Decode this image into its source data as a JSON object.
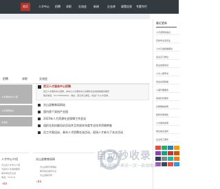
{
  "nav": {
    "items": [
      {
        "label": "首页",
        "active": true
      },
      {
        "label": "人才中心"
      },
      {
        "label": "招聘"
      },
      {
        "label": "求职"
      },
      {
        "label": "交流会"
      },
      {
        "label": "新闻"
      },
      {
        "label": "企业库"
      },
      {
        "label": "政策信息"
      },
      {
        "label": "专题专栏"
      }
    ]
  },
  "sidebar": {
    "title": "最近更新",
    "items": [
      "人才招聘会信息",
      "高校毕业生就业",
      "人才引进政策解读",
      "就业见习岗位",
      "职业技能培训",
      "人才公寓申请",
      "创业扶持政策",
      "人事代理服务",
      "档案托管服务",
      "社保缴纳指南",
      "职称评审通知",
      "人才服务指南",
      "岗位信息发布",
      "企业用工服务"
    ]
  },
  "tabs": [
    "招聘",
    "求职",
    "交流会"
  ],
  "thumbs": [
    {
      "label": "人才服务中心介绍"
    },
    {
      "label": "人才招聘信息"
    },
    {
      "label": "交流会"
    }
  ],
  "headline": {
    "title": "武汉人才服务中心招聘",
    "desc_lines": [
      "武汉人才服务中心招聘，本中心人才服务中心办理毕业生档案等相关服务",
      "联系电话：027-85550000，地址：武汉市江岸区，欢迎广大人才咨询"
    ]
  },
  "news_list": [
    "光山县教育局网站",
    "国内首个双创产业园",
    "2023年人力资源社会保障工作会议",
    "组织业务技能培训活动并且完成本年度专业技术资格审查",
    "员工代表培训，青年人才招聘交流活动，现场人才参与了本次活动"
  ],
  "panels": {
    "left": {
      "title": "人才中心介绍",
      "lines": [
        "光山县人才中心介绍",
        "为县内人才提供服务",
        "联系地址光山县",
        "电话：0376-8"
      ]
    },
    "mid": {
      "title": "光山县教育局网",
      "lines": [
        "光山县教育局网站",
        "教育信息发布平台",
        "光山县教育局"
      ],
      "more": "+更多"
    },
    "left_more": "+更多"
  },
  "grid_colors": [
    "#e74c3c",
    "#27ae60",
    "#2980b9",
    "#f39c12",
    "#8e44ad",
    "#16a085",
    "#c0392b",
    "#d35400",
    "#2c3e50",
    "#7f8c8d",
    "#1abc9c",
    "#e67e22",
    "#9b59b6",
    "#34495e",
    "#e74c3c",
    "#3498db"
  ],
  "watermark": {
    "title": "自动秒收录",
    "sub": "做上链接一来访一次一自动收录"
  }
}
